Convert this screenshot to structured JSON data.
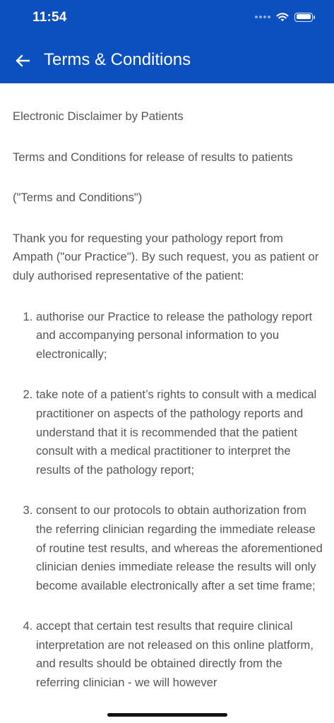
{
  "status_bar": {
    "time": "11:54",
    "battery_level": 1.0
  },
  "header": {
    "title": "Terms & Conditions",
    "back_icon": "arrow-left-icon",
    "background_color": "#0b4fc1"
  },
  "content": {
    "heading": "Electronic Disclaimer by Patients",
    "subheading": "Terms and Conditions for release of results to patients",
    "quoted_title": "(\"Terms and Conditions\")",
    "intro": "Thank you for requesting your pathology report from Ampath (\"our Practice\"). By such request, you as patient or duly authorised representative of the patient:",
    "items": [
      "authorise our Practice to release the pathology report and accompanying personal information to you electronically;",
      "take note of a patient’s rights to consult with a medical practitioner on aspects of the pathology reports and understand that it is recommended that the patient consult with a medical practitioner to interpret the results of the pathology report;",
      "consent to our protocols to obtain authorization from the referring clinician regarding the immediate release of routine test results, and whereas the aforementioned clinician denies immediate release the results will only become available electronically after a set time frame;",
      "accept that certain test results that require clinical interpretation are not released on this online platform, and results should be obtained directly from the referring clinician - we will however"
    ]
  }
}
